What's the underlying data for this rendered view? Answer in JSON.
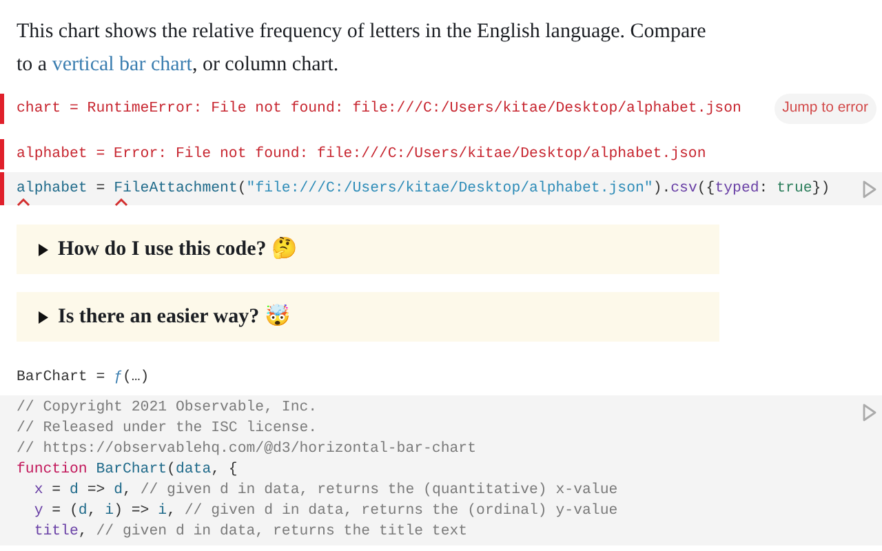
{
  "intro": {
    "before": "This chart shows the relative frequency of letters in the English language. Compare to a ",
    "link": "vertical bar chart",
    "after": ", or column chart."
  },
  "errors": [
    {
      "text": "chart = RuntimeError: File not found: file:///C:/Users/kitae/Desktop/alphabet.json",
      "action": "Jump to error"
    },
    {
      "text": "alphabet = Error: File not found: file:///C:/Users/kitae/Desktop/alphabet.json"
    }
  ],
  "source_cell": {
    "focused": true,
    "tokens": [
      {
        "kind": "var",
        "text": "alphabet",
        "marked": true
      },
      {
        "kind": "plain",
        "text": " = ",
        "marked": false
      },
      {
        "kind": "var",
        "text": "FileAttachment",
        "marked": true
      },
      {
        "kind": "plain",
        "text": "(",
        "marked": false
      },
      {
        "kind": "string",
        "text": "\"file:///C:/Users/kitae/Desktop/alphabet.json\"",
        "marked": false
      },
      {
        "kind": "plain",
        "text": ").",
        "marked": false
      },
      {
        "kind": "param",
        "text": "csv",
        "marked": false
      },
      {
        "kind": "plain",
        "text": "({",
        "marked": false
      },
      {
        "kind": "param",
        "text": "typed",
        "marked": false
      },
      {
        "kind": "plain",
        "text": ": ",
        "marked": false
      },
      {
        "kind": "bool",
        "text": "true",
        "marked": false
      },
      {
        "kind": "plain",
        "text": "})",
        "marked": false
      }
    ]
  },
  "details": [
    {
      "summary": "How do I use this code? 🤔",
      "expanded": false
    },
    {
      "summary": "Is there an easier way? 🤯",
      "expanded": false
    }
  ],
  "collapsed_cell": {
    "name": "BarChart",
    "equals": " = ",
    "fn": "ƒ",
    "rest": "(…)"
  },
  "code_cell": {
    "lines": [
      {
        "indent": false,
        "tokens": [
          {
            "kind": "comment",
            "text": "// Copyright 2021 Observable, Inc."
          }
        ]
      },
      {
        "indent": false,
        "tokens": [
          {
            "kind": "comment",
            "text": "// Released under the ISC license."
          }
        ]
      },
      {
        "indent": false,
        "tokens": [
          {
            "kind": "comment",
            "text": "// https://observablehq.com/@d3/horizontal-bar-chart"
          }
        ]
      },
      {
        "indent": false,
        "tokens": [
          {
            "kind": "keyword",
            "text": "function"
          },
          {
            "kind": "var",
            "text": "BarChart"
          },
          {
            "kind": "plain",
            "text": "("
          },
          {
            "kind": "var",
            "text": "data"
          },
          {
            "kind": "plain",
            "text": ", {"
          }
        ]
      },
      {
        "indent": true,
        "tokens": [
          {
            "kind": "param",
            "text": "x"
          },
          {
            "kind": "plain",
            "text": " = "
          },
          {
            "kind": "var",
            "text": "d"
          },
          {
            "kind": "plain",
            "text": " => "
          },
          {
            "kind": "var",
            "text": "d"
          },
          {
            "kind": "plain",
            "text": ", "
          },
          {
            "kind": "comment",
            "text": "// given d in data, returns the (quantitative) x-value"
          }
        ]
      },
      {
        "indent": true,
        "tokens": [
          {
            "kind": "param",
            "text": "y"
          },
          {
            "kind": "plain",
            "text": " = ("
          },
          {
            "kind": "var",
            "text": "d"
          },
          {
            "kind": "plain",
            "text": ", "
          },
          {
            "kind": "var",
            "text": "i"
          },
          {
            "kind": "plain",
            "text": ") => "
          },
          {
            "kind": "var",
            "text": "i"
          },
          {
            "kind": "plain",
            "text": ", "
          },
          {
            "kind": "comment",
            "text": "// given d in data, returns the (ordinal) y-value"
          }
        ]
      },
      {
        "indent": true,
        "tokens": [
          {
            "kind": "param",
            "text": "title"
          },
          {
            "kind": "plain",
            "text": ", "
          },
          {
            "kind": "comment",
            "text": "// given d in data, returns the title text"
          }
        ]
      }
    ]
  }
}
